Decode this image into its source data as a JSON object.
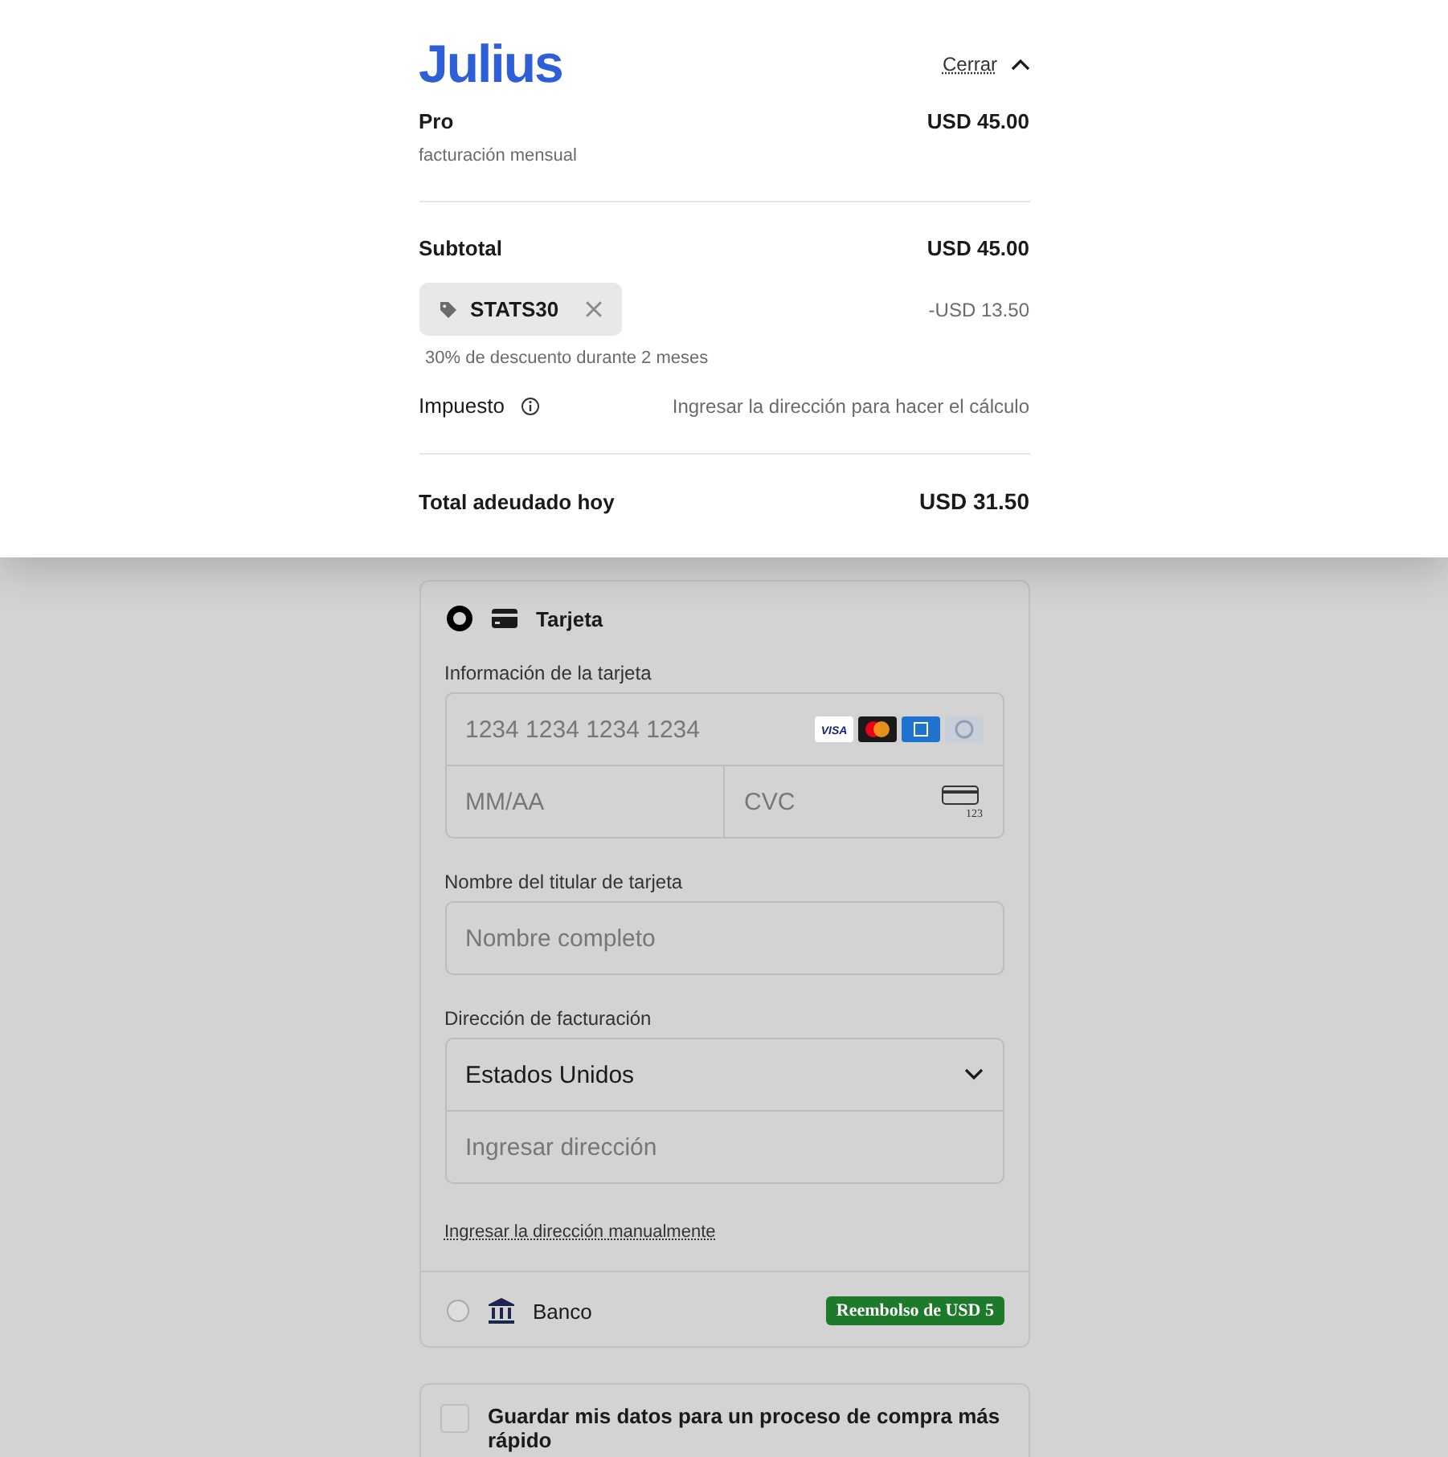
{
  "summary": {
    "logo": "Julius",
    "close_label": "Cerrar",
    "expanded": true,
    "plan": {
      "name": "Pro",
      "billing": "facturación mensual",
      "price": "USD 45.00"
    },
    "subtotal": {
      "label": "Subtotal",
      "amount": "USD 45.00"
    },
    "discount": {
      "code": "STATS30",
      "amount": "-USD 13.50",
      "note": "30% de descuento durante 2 meses"
    },
    "tax": {
      "label": "Impuesto",
      "value": "Ingresar la dirección para hacer el cálculo"
    },
    "total": {
      "label": "Total adeudado hoy",
      "amount": "USD 31.50"
    }
  },
  "payment_methods": [
    {
      "kind": "card",
      "label": "Tarjeta",
      "selected": true
    },
    {
      "kind": "bank",
      "label": "Banco",
      "selected": false,
      "badge": "Reembolso de USD 5"
    }
  ],
  "card_form": {
    "card_info_label": "Información de la tarjeta",
    "number_placeholder": "1234 1234 1234 1234",
    "brands": [
      {
        "kind": "visa",
        "text": "VISA"
      },
      {
        "kind": "mastercard"
      },
      {
        "kind": "amex"
      },
      {
        "kind": "diners"
      }
    ],
    "expiry_placeholder": "MM/AA",
    "cvc_placeholder": "CVC",
    "cvc_icon_text": "123",
    "holder_label": "Nombre del titular de tarjeta",
    "holder_placeholder": "Nombre completo",
    "address_label": "Dirección de facturación",
    "country": "Estados Unidos",
    "address_placeholder": "Ingresar dirección",
    "manual_link": "Ingresar la dirección manualmente"
  },
  "save_info": {
    "label": "Guardar mis datos para un proceso de compra más rápido",
    "checked": false
  }
}
